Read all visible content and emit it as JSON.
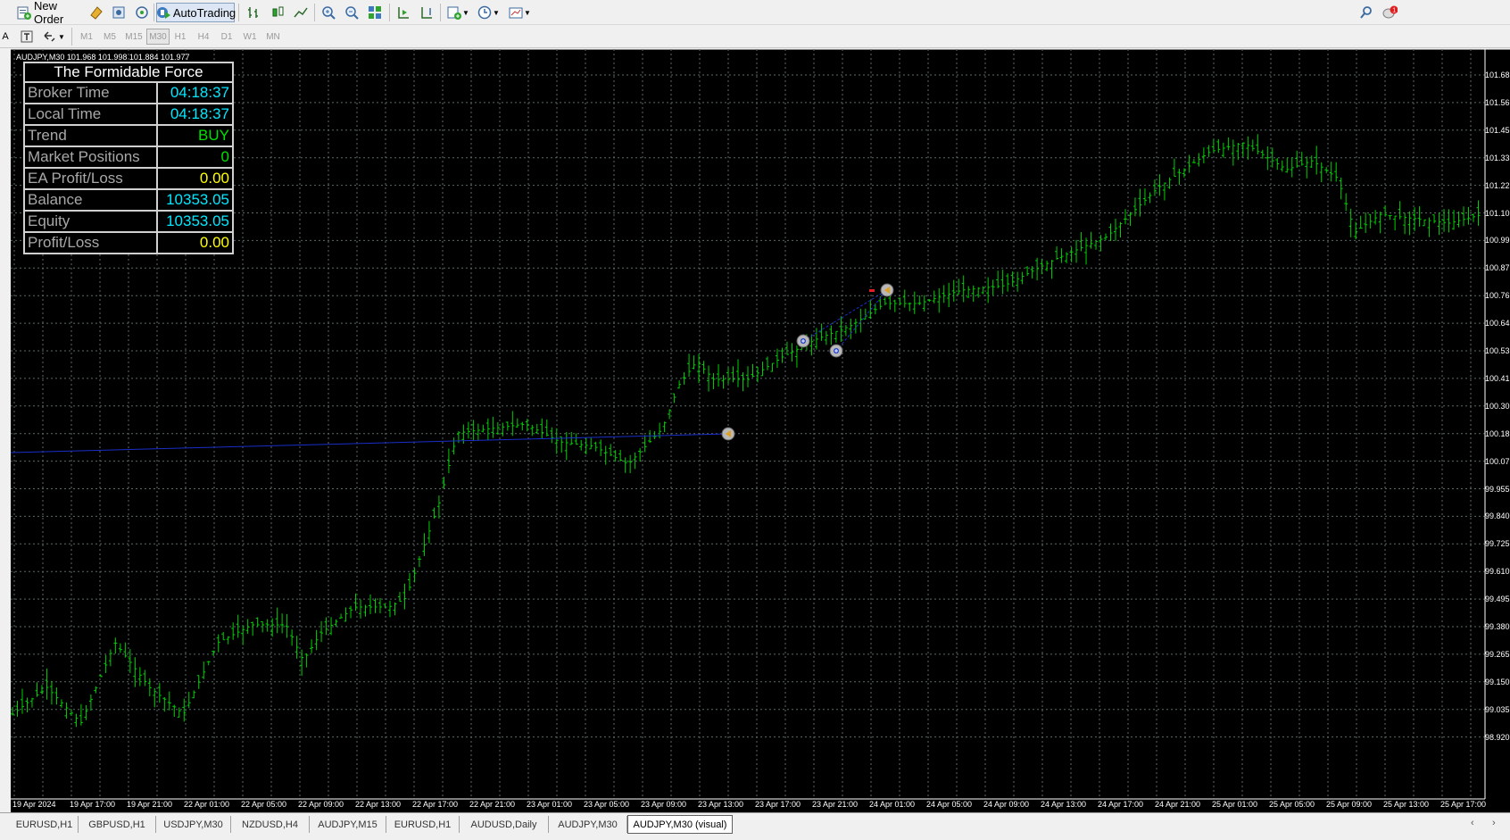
{
  "toolbar": {
    "new_order_label": "New Order",
    "autotrading_label": "AutoTrading",
    "timeframes": [
      "M1",
      "M5",
      "M15",
      "M30",
      "H1",
      "H4",
      "D1",
      "W1",
      "MN"
    ],
    "active_timeframe": "M30"
  },
  "chart": {
    "symbol_info": "AUDJPY,M30  101.968 101.998 101.884 101.977",
    "background": "#000000",
    "grid_color": "#5a6a6a",
    "candle_color": "#00d000",
    "trend_line_color": "#1a2ec8",
    "y_labels": [
      "101.68",
      "101.56",
      "101.45",
      "101.33",
      "101.22",
      "101.10",
      "100.99",
      "100.87",
      "100.76",
      "100.64",
      "100.53",
      "100.41",
      "100.30",
      "100.18",
      "100.07",
      "99.955",
      "99.840",
      "99.725",
      "99.610",
      "99.495",
      "99.380",
      "99.265",
      "99.150",
      "99.035",
      "98.920"
    ],
    "x_labels": [
      "19 Apr 2024",
      "19 Apr 17:00",
      "19 Apr 21:00",
      "22 Apr 01:00",
      "22 Apr 05:00",
      "22 Apr 09:00",
      "22 Apr 13:00",
      "22 Apr 17:00",
      "22 Apr 21:00",
      "23 Apr 01:00",
      "23 Apr 05:00",
      "23 Apr 09:00",
      "23 Apr 13:00",
      "23 Apr 17:00",
      "23 Apr 21:00",
      "24 Apr 01:00",
      "24 Apr 05:00",
      "24 Apr 09:00",
      "24 Apr 13:00",
      "24 Apr 17:00",
      "24 Apr 21:00",
      "25 Apr 01:00",
      "25 Apr 05:00",
      "25 Apr 09:00",
      "25 Apr 13:00",
      "25 Apr 17:00"
    ]
  },
  "panel": {
    "title": "The Formidable Force",
    "rows": [
      {
        "label": "Broker Time",
        "value": "04:18:37",
        "color": "#00e8ff"
      },
      {
        "label": "Local Time",
        "value": "04:18:37",
        "color": "#00e8ff"
      },
      {
        "label": "Trend",
        "value": "BUY",
        "color": "#00e000"
      },
      {
        "label": "Market Positions",
        "value": "0",
        "color": "#00e000"
      },
      {
        "label": "EA Profit/Loss",
        "value": "0.00",
        "color": "#ffff00"
      },
      {
        "label": "Balance",
        "value": "10353.05",
        "color": "#00e8ff"
      },
      {
        "label": "Equity",
        "value": "10353.05",
        "color": "#00e8ff"
      },
      {
        "label": "Profit/Loss",
        "value": "0.00",
        "color": "#ffff00"
      }
    ]
  },
  "tabs": [
    "EURUSD,H1",
    "GBPUSD,H1",
    "USDJPY,M30",
    "NZDUSD,H4",
    "AUDJPY,M15",
    "EURUSD,H1",
    "AUDUSD,Daily",
    "AUDJPY,M30",
    "AUDJPY,M30 (visual)"
  ],
  "active_tab": "AUDJPY,M30 (visual)"
}
